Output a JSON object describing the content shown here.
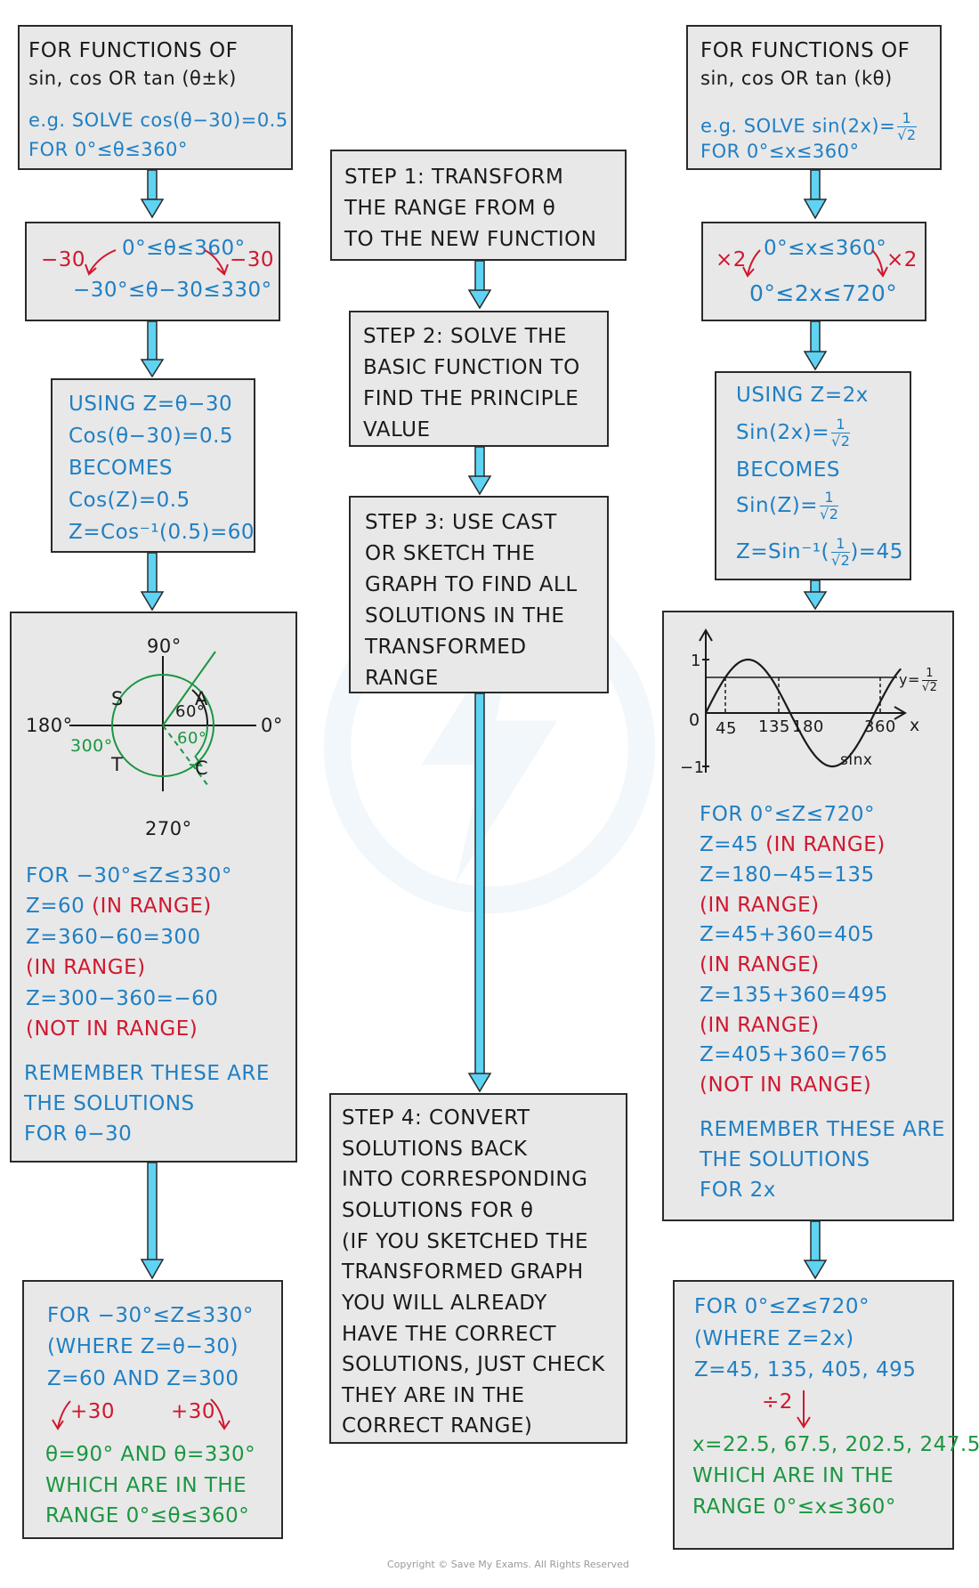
{
  "left": {
    "box1": {
      "line1": "FOR  FUNCTIONS  OF",
      "line2": "sin, cos  OR  tan (θ±k)",
      "line3": "e.g. SOLVE  cos(θ−30)=0.5",
      "line4": "FOR  0°≤θ≤360°"
    },
    "box2": {
      "top": "0°≤θ≤360°",
      "bottom": "−30°≤θ−30≤330°",
      "left_op": "−30",
      "right_op": "−30"
    },
    "box3": {
      "lines": [
        "USING   Z=θ−30",
        "Cos(θ−30)=0.5",
        "BECOMES",
        "Cos(Z)=0.5",
        "Z=Cos⁻¹(0.5)=60"
      ]
    },
    "cast": {
      "label_90": "90°",
      "label_0": "0°",
      "label_180": "180°",
      "label_270": "270°",
      "label_S": "S",
      "label_A": "A",
      "label_T": "T",
      "label_C": "C",
      "angle_upper": "60°",
      "angle_lower": "60°",
      "angle_300": "300°"
    },
    "box4": {
      "lines": [
        {
          "text": "FOR  −30°≤Z≤330°",
          "color": "blue"
        },
        {
          "text": "Z=60",
          "color": "blue",
          "suffix": " (IN  RANGE)"
        },
        {
          "text": "Z=360−60=300",
          "color": "blue"
        },
        {
          "text": "(IN  RANGE)",
          "color": "red"
        },
        {
          "text": "Z=300−360=−60",
          "color": "blue"
        },
        {
          "text": "(NOT  IN  RANGE)",
          "color": "red"
        },
        {
          "text": "REMEMBER  THESE  ARE",
          "color": "blue"
        },
        {
          "text": "THE  SOLUTIONS",
          "color": "blue"
        },
        {
          "text": "FOR  θ−30",
          "color": "blue"
        }
      ]
    },
    "box5": {
      "line1": "FOR   −30°≤Z≤330°",
      "line2": "(WHERE  Z=θ−30)",
      "line3": "Z=60  AND  Z=300",
      "op_left": "+30",
      "op_right": "+30",
      "line4": "θ=90°  AND  θ=330°",
      "line5": "WHICH  ARE  IN  THE",
      "line6": "RANGE   0°≤θ≤360°"
    }
  },
  "middle": {
    "step1": [
      "STEP 1:  TRANSFORM",
      "THE  RANGE  FROM  θ",
      "TO  THE  NEW  FUNCTION"
    ],
    "step2": [
      "STEP 2:  SOLVE   THE",
      "BASIC  FUNCTION  TO",
      "FIND  THE  PRINCIPLE",
      "VALUE"
    ],
    "step3": [
      "STEP 3:  USE   CAST",
      "OR  SKETCH  THE",
      "GRAPH  TO  FIND  ALL",
      "SOLUTIONS  IN  THE",
      "TRANSFORMED",
      "RANGE"
    ],
    "step4": [
      "STEP 4:  CONVERT",
      "SOLUTIONS   BACK",
      "INTO  CORRESPONDING",
      "SOLUTIONS   FOR   θ",
      "(IF  YOU  SKETCHED  THE",
      "TRANSFORMED   GRAPH",
      "YOU   WILL   ALREADY",
      "HAVE   THE   CORRECT",
      "SOLUTIONS,  JUST  CHECK",
      "THEY  ARE   IN   THE",
      "CORRECT    RANGE)"
    ]
  },
  "right": {
    "box1": {
      "line1": "FOR  FUNCTIONS  OF",
      "line2": "sin, cos  OR  tan (kθ)",
      "line3": "e.g.  SOLVE   sin(2x)=",
      "frac_num": "1",
      "frac_den": "√2",
      "line4": "FOR  0°≤x≤360°"
    },
    "box2": {
      "top": "0°≤x≤360°",
      "bottom": "0°≤2x≤720°",
      "left_op": "×2",
      "right_op": "×2"
    },
    "box3": {
      "line1": "USING   Z=2x",
      "line2": "Sin(2x)=",
      "line3": "BECOMES",
      "line4": "Sin(Z)=",
      "line5a": "Z=Sin⁻¹(",
      "line5b": ")=45",
      "frac_num": "1",
      "frac_den": "√2"
    },
    "graph": {
      "y_label_1": "1",
      "y_label_neg1": "−1",
      "origin": "0",
      "x_axis": "x",
      "ticks": [
        "45",
        "135",
        "180",
        "360"
      ],
      "curve_label": "sinx",
      "line_label": "y=",
      "line_frac_num": "1",
      "line_frac_den": "√2"
    },
    "box4": {
      "lines": [
        {
          "text": "FOR   0°≤Z≤720°",
          "color": "blue"
        },
        {
          "text": "Z=45",
          "color": "blue",
          "suffix": "  (IN  RANGE)"
        },
        {
          "text": "Z=180−45=135",
          "color": "blue"
        },
        {
          "text": "(IN  RANGE)",
          "color": "red"
        },
        {
          "text": "Z=45+360=405",
          "color": "blue"
        },
        {
          "text": "(IN  RANGE)",
          "color": "red"
        },
        {
          "text": "Z=135+360=495",
          "color": "blue"
        },
        {
          "text": "(IN  RANGE)",
          "color": "red"
        },
        {
          "text": "Z=405+360=765",
          "color": "blue"
        },
        {
          "text": "(NOT  IN  RANGE)",
          "color": "red"
        },
        {
          "text": "REMEMBER  THESE  ARE",
          "color": "blue"
        },
        {
          "text": "THE  SOLUTIONS",
          "color": "blue"
        },
        {
          "text": "FOR  2x",
          "color": "blue"
        }
      ]
    },
    "box5": {
      "line1": "FOR   0°≤Z≤720°",
      "line2": "(WHERE   Z=2x)",
      "line3": "Z=45, 135, 405, 495",
      "op": "÷2",
      "line4": "x=22.5, 67.5, 202.5, 247.5",
      "line5": "WHICH   ARE  IN  THE",
      "line6": "RANGE   0°≤x≤360°"
    }
  },
  "footer": {
    "copyright": "Copyright © Save My Exams. All Rights Reserved"
  },
  "colors": {
    "blue": "#1f7fc4",
    "red": "#d0172f",
    "green": "#1a9640",
    "arrow": "#5fd3f3",
    "box": "#e8e8e8"
  }
}
